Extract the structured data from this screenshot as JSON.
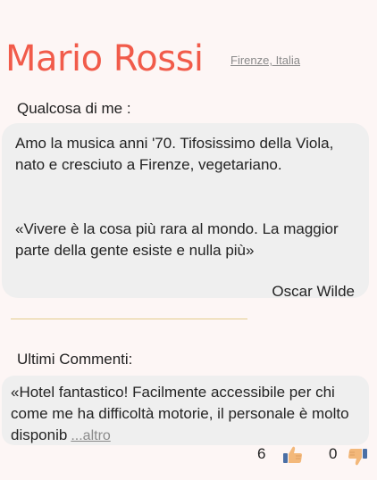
{
  "profile": {
    "name": "Mario Rossi",
    "location": "Firenze, Italia"
  },
  "about": {
    "label": "Qualcosa di me :",
    "text": "Amo la musica anni '70. Tifosissimo della Viola, nato e cresciuto a Firenze, vegetariano.",
    "quote": "«Vivere è la cosa più rara al mondo. La maggior parte della gente esiste e nulla più»",
    "quote_author": "Oscar Wilde"
  },
  "comments": {
    "label": "Ultimi Commenti:",
    "items": [
      {
        "text": "«Hotel fantastico! Facilmente accessibile per chi come me ha difficoltà motorie, il personale è molto disponib",
        "more_label": "...altro",
        "likes": "6",
        "dislikes": "0"
      }
    ]
  },
  "colors": {
    "name": "#f15b4a",
    "thumb_up": "#f3b87a",
    "thumb_down": "#f3b87a",
    "cuff": "#4a6fa5"
  },
  "icons": {
    "like": "thumbs-up-icon",
    "dislike": "thumbs-down-icon"
  }
}
